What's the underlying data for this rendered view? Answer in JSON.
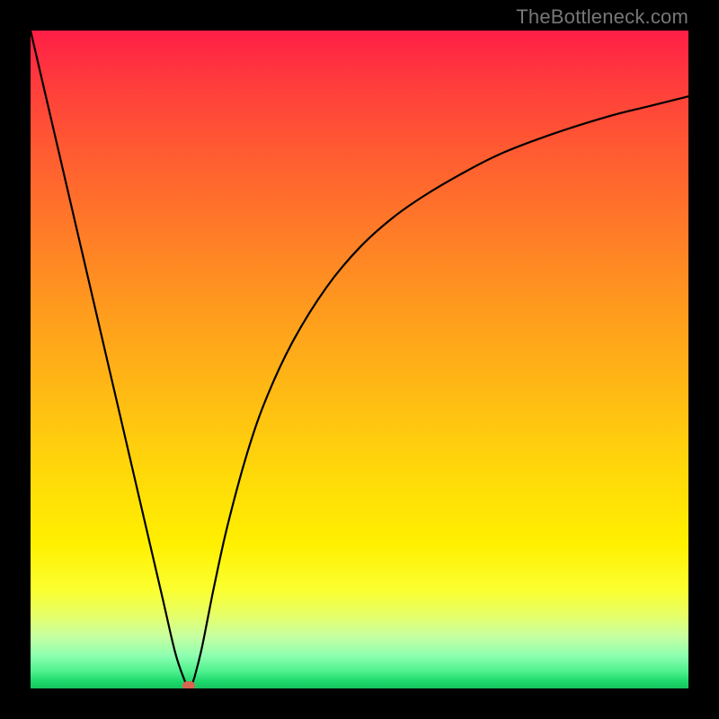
{
  "watermark": "TheBottleneck.com",
  "chart_data": {
    "type": "line",
    "title": "",
    "xlabel": "",
    "ylabel": "",
    "xlim": [
      0,
      100
    ],
    "ylim": [
      0,
      100
    ],
    "grid": false,
    "legend": false,
    "gradient_stops": [
      {
        "pos": 0,
        "color": "#ff1e46"
      },
      {
        "pos": 18,
        "color": "#ff5a32"
      },
      {
        "pos": 42,
        "color": "#ff9a1e"
      },
      {
        "pos": 67,
        "color": "#ffd80a"
      },
      {
        "pos": 85,
        "color": "#fbff30"
      },
      {
        "pos": 95,
        "color": "#8effb0"
      },
      {
        "pos": 100,
        "color": "#17c45f"
      }
    ],
    "series": [
      {
        "name": "bottleneck-curve",
        "x": [
          0,
          4,
          8,
          12,
          16,
          20,
          22,
          23.5,
          24,
          24.5,
          25,
          26,
          27,
          28,
          30,
          33,
          36,
          40,
          45,
          50,
          55,
          60,
          66,
          72,
          80,
          88,
          94,
          100
        ],
        "y": [
          100,
          82.8,
          65.6,
          48.4,
          31.2,
          14.0,
          5.4,
          1.0,
          0.0,
          0.6,
          2.0,
          6.0,
          11.0,
          16.0,
          25.0,
          36.0,
          44.5,
          53.0,
          61.0,
          67.0,
          71.5,
          75.0,
          78.5,
          81.5,
          84.5,
          87.0,
          88.5,
          90.0
        ]
      }
    ],
    "annotations": [
      {
        "name": "min-marker",
        "x": 24,
        "y": 0,
        "color": "#d9644f",
        "shape": "pill"
      }
    ]
  }
}
